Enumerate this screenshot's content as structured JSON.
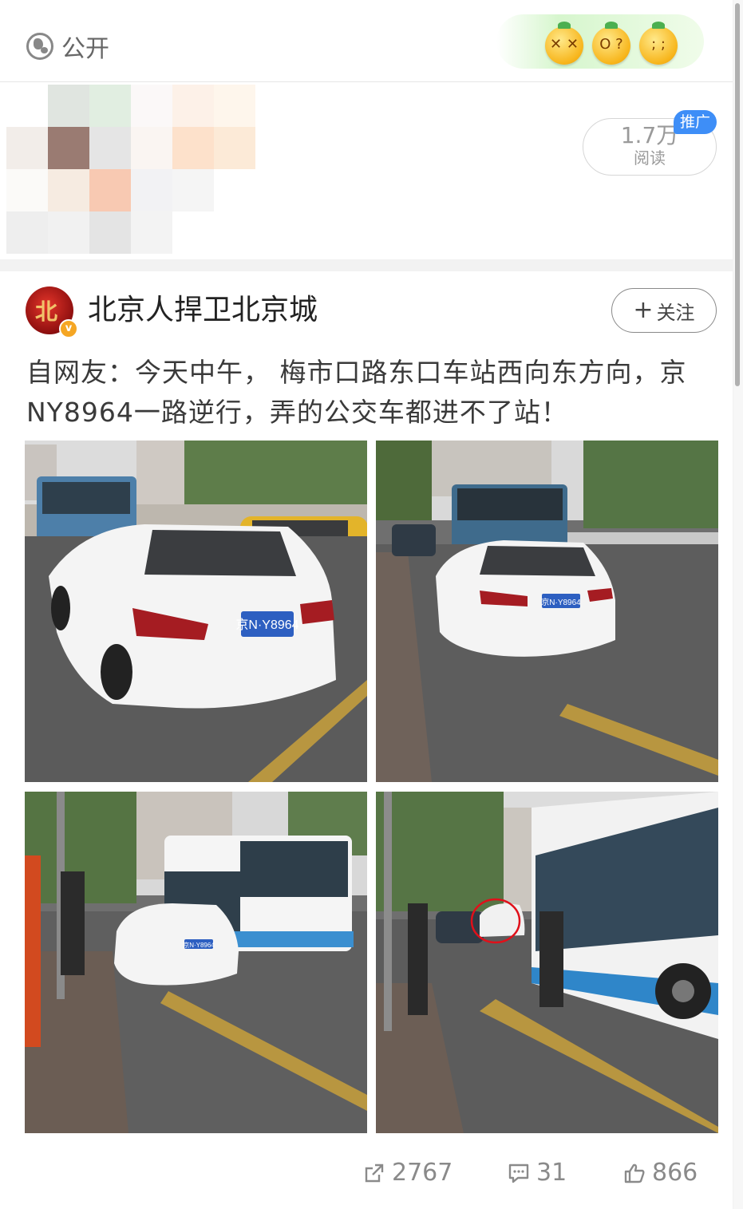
{
  "topbar": {
    "visibility_label": "公开",
    "visibility_icon": "globe-icon",
    "reactions": [
      {
        "icon": "dizzy-face-icon",
        "face": "✕ ✕"
      },
      {
        "icon": "shocked-face-icon",
        "face": "O ?"
      },
      {
        "icon": "crying-face-icon",
        "face": "; ;"
      }
    ]
  },
  "ad": {
    "reads_count": "1.7万",
    "reads_label": "阅读",
    "promo_badge": "推广",
    "mosaic_colors": [
      "#ffffff",
      "#e0e5e0",
      "#e1eee1",
      "#fbf8f8",
      "#fdf1e8",
      "#fef6ec",
      "#f2ede9",
      "#9a7b72",
      "#e5e5e5",
      "#faf5f2",
      "#fde1cb",
      "#fcead7",
      "#fbfaf8",
      "#f6ebe1",
      "#f8c9b2",
      "#f2f2f4",
      "#f5f5f5",
      "#ffffff",
      "#eeeeee",
      "#f1f1f1",
      "#e4e4e4",
      "#f3f3f3",
      "#ffffff",
      "#ffffff"
    ]
  },
  "post": {
    "author": "北京人捍卫北京城",
    "avatar_char": "北",
    "verified_mark": "v",
    "follow_label": "关注",
    "text": "自网友：今天中午， 梅市口路东口车站西向东方向，京NY8964一路逆行，弄的公交车都进不了站！",
    "photos": [
      {
        "plate": "京N·Y8964"
      },
      {
        "plate": "京N·Y8964"
      },
      {
        "plate": "京N·Y8964"
      },
      {
        "plate": ""
      }
    ],
    "actions": {
      "repost_count": "2767",
      "comment_count": "31",
      "like_count": "866"
    }
  }
}
